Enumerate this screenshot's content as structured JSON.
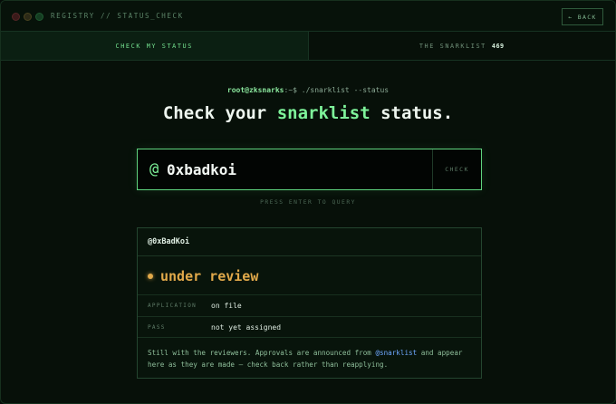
{
  "window": {
    "title": "REGISTRY // STATUS_CHECK",
    "back_label": "← BACK"
  },
  "tabs": [
    {
      "label": "CHECK MY STATUS",
      "active": true
    },
    {
      "label": "THE SNARKLIST",
      "count": "469",
      "active": false
    }
  ],
  "prompt": {
    "user": "root@zksnarks",
    "separator": ":~$",
    "command": " ./snarklist --status"
  },
  "heading": {
    "before": "Check your ",
    "accent": "snarklist",
    "after": " status."
  },
  "search": {
    "prefix": "@",
    "value": "0xbadkoi",
    "button_label": "CHECK",
    "hint": "PRESS ENTER TO QUERY"
  },
  "result": {
    "handle": "@0xBadKoi",
    "status": "under review",
    "rows": [
      {
        "key": "APPLICATION",
        "value": "on file"
      },
      {
        "key": "PASS",
        "value": "not yet assigned"
      }
    ],
    "note_before": "Still with the reviewers. Approvals are announced from ",
    "note_mention": "@snarklist",
    "note_after": " and appear here as they are made — check back rather than reapplying."
  },
  "colors": {
    "accent": "#7ef39a",
    "status_pending": "#e1a94a",
    "mention": "#6ea8ff"
  }
}
